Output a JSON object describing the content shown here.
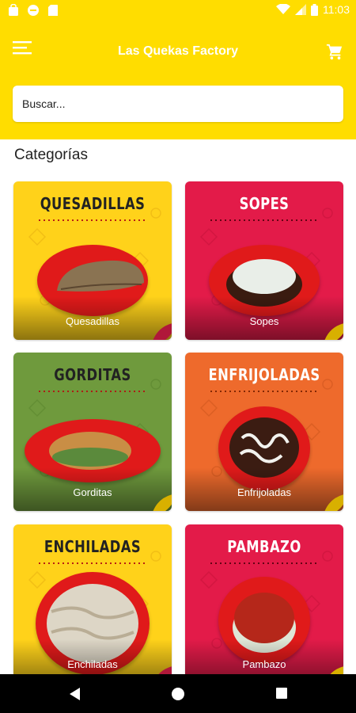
{
  "status_bar": {
    "time": "11:03"
  },
  "app_bar": {
    "title": "Las Quekas Factory"
  },
  "search": {
    "placeholder": "Buscar..."
  },
  "section": {
    "title": "Categorías"
  },
  "categories": [
    {
      "heading": "QUESADILLAS",
      "label": "Quesadillas",
      "bg": "#ffd21a",
      "food": "quesadilla"
    },
    {
      "heading": "SOPES",
      "label": "Sopes",
      "bg": "#e31b49",
      "food": "sope"
    },
    {
      "heading": "GORDITAS",
      "label": "Gorditas",
      "bg": "#6f9a3d",
      "food": "gordita"
    },
    {
      "heading": "ENFRIJOLADAS",
      "label": "Enfrijoladas",
      "bg": "#ee6a2c",
      "food": "enfrijolada"
    },
    {
      "heading": "ENCHILADAS",
      "label": "Enchiladas",
      "bg": "#ffd21a",
      "food": "enchilada"
    },
    {
      "heading": "PAMBAZO",
      "label": "Pambazo",
      "bg": "#e31b49",
      "food": "pambazo"
    }
  ],
  "colors": {
    "brand": "#ffdd00",
    "plate": "#e01a1a",
    "nav": "#000000"
  },
  "icons": {
    "menu": "menu-icon",
    "cart": "cart-icon",
    "back": "back-icon",
    "home": "home-icon",
    "recents": "recents-icon"
  }
}
